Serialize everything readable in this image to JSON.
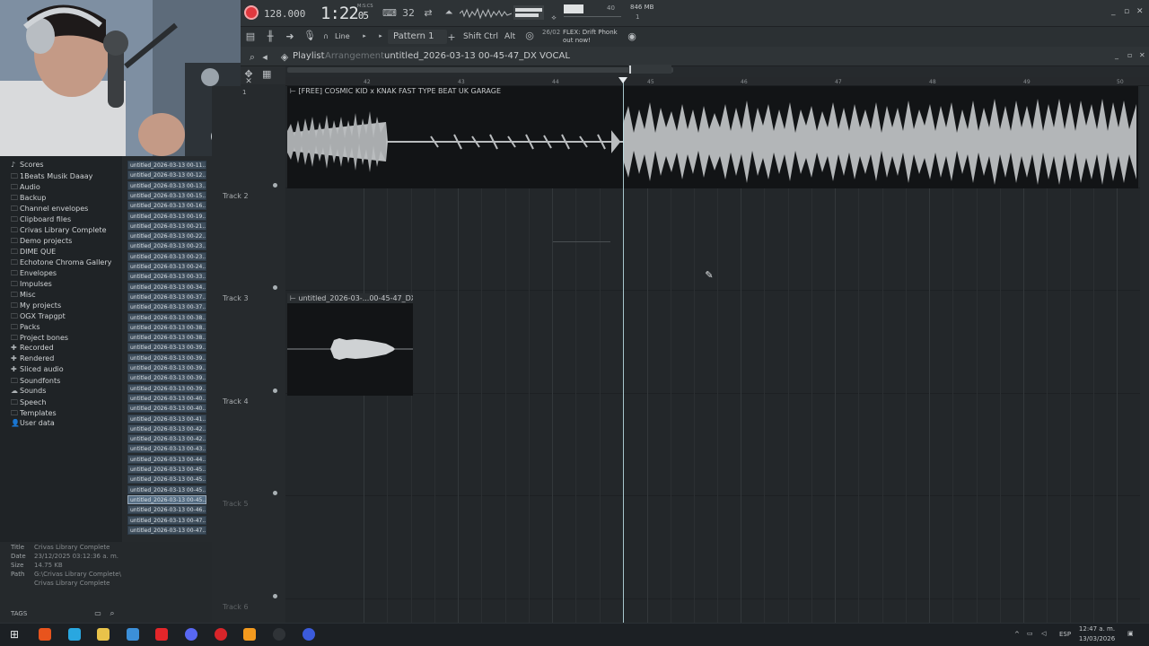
{
  "transport": {
    "tempo": "128.000",
    "time_main": "1:22",
    "time_sub": "05",
    "time_label": "M:S:CS",
    "step_label": "32",
    "master_level": "40",
    "memory": "846 MB",
    "memory_sub": "1",
    "snap": "Line",
    "pattern": "Pattern 1",
    "keys": [
      "Shift",
      "Ctrl",
      "Alt"
    ],
    "news_date": "26/02",
    "news_text": "FLEX: Drift Phonk out now!"
  },
  "playlist": {
    "title": "Playlist",
    "arrangement": "Arrangement",
    "clip_path": "untitled_2026-03-13 00-45-47_DX VOCAL",
    "ruler": [
      "42",
      "43",
      "44",
      "45",
      "46",
      "47",
      "48",
      "49",
      "50"
    ],
    "tracks": [
      "Track 2",
      "Track 3",
      "Track 4",
      "Track 5",
      "Track 6"
    ],
    "track1_number": "1",
    "clips": {
      "beat": "[FREE] COSMIC KID x KNAK FAST TYPE BEAT  UK GARAGE",
      "vocal": "untitled_2026-03-...00-45-47_DX VOCAL"
    }
  },
  "browser": {
    "items": [
      {
        "icon": "note-icon",
        "glyph": "♪",
        "label": "Scores"
      },
      {
        "icon": "folder-icon",
        "glyph": "🗀",
        "label": "1Beats Musik Daaay"
      },
      {
        "icon": "folder-icon",
        "glyph": "🗀",
        "label": "Audio"
      },
      {
        "icon": "folder-icon",
        "glyph": "🗀",
        "label": "Backup"
      },
      {
        "icon": "folder-icon",
        "glyph": "🗀",
        "label": "Channel envelopes"
      },
      {
        "icon": "folder-icon",
        "glyph": "🗀",
        "label": "Clipboard files"
      },
      {
        "icon": "folder-icon",
        "glyph": "🗀",
        "label": "Crivas Library Complete"
      },
      {
        "icon": "folder-icon",
        "glyph": "🗀",
        "label": "Demo projects"
      },
      {
        "icon": "folder-icon",
        "glyph": "🗀",
        "label": "DIME QUE"
      },
      {
        "icon": "folder-icon",
        "glyph": "🗀",
        "label": "Echotone Chroma Gallery"
      },
      {
        "icon": "folder-icon",
        "glyph": "🗀",
        "label": "Envelopes"
      },
      {
        "icon": "folder-icon",
        "glyph": "🗀",
        "label": "Impulses"
      },
      {
        "icon": "folder-icon",
        "glyph": "🗀",
        "label": "Misc"
      },
      {
        "icon": "folder-icon",
        "glyph": "🗀",
        "label": "My projects"
      },
      {
        "icon": "folder-icon",
        "glyph": "🗀",
        "label": "OGX Trapgpt"
      },
      {
        "icon": "folder-icon",
        "glyph": "🗀",
        "label": "Packs"
      },
      {
        "icon": "folder-icon",
        "glyph": "🗀",
        "label": "Project bones"
      },
      {
        "icon": "plus-icon",
        "glyph": "✚",
        "label": "Recorded"
      },
      {
        "icon": "plus-icon",
        "glyph": "✚",
        "label": "Rendered"
      },
      {
        "icon": "plus-icon",
        "glyph": "✚",
        "label": "Sliced audio"
      },
      {
        "icon": "folder-icon",
        "glyph": "🗀",
        "label": "Soundfonts"
      },
      {
        "icon": "cloud-icon",
        "glyph": "☁",
        "label": "Sounds"
      },
      {
        "icon": "folder-icon",
        "glyph": "🗀",
        "label": "Speech"
      },
      {
        "icon": "folder-icon",
        "glyph": "🗀",
        "label": "Templates"
      },
      {
        "icon": "user-icon",
        "glyph": "👤",
        "label": "User data"
      }
    ],
    "files": [
      "untitled_2026-03-13 00-11...",
      "untitled_2026-03-13 00-12...",
      "untitled_2026-03-13 00-13...",
      "untitled_2026-03-13 00-15...",
      "untitled_2026-03-13 00-16...",
      "untitled_2026-03-13 00-19...",
      "untitled_2026-03-13 00-21...",
      "untitled_2026-03-13 00-22...",
      "untitled_2026-03-13 00-23...",
      "untitled_2026-03-13 00-23...",
      "untitled_2026-03-13 00-24...",
      "untitled_2026-03-13 00-33...",
      "untitled_2026-03-13 00-34...",
      "untitled_2026-03-13 00-37...",
      "untitled_2026-03-13 00-37...",
      "untitled_2026-03-13 00-38...",
      "untitled_2026-03-13 00-38...",
      "untitled_2026-03-13 00-38...",
      "untitled_2026-03-13 00-39...",
      "untitled_2026-03-13 00-39...",
      "untitled_2026-03-13 00-39...",
      "untitled_2026-03-13 00-39...",
      "untitled_2026-03-13 00-39...",
      "untitled_2026-03-13 00-40...",
      "untitled_2026-03-13 00-40...",
      "untitled_2026-03-13 00-41...",
      "untitled_2026-03-13 00-42...",
      "untitled_2026-03-13 00-42...",
      "untitled_2026-03-13 00-43...",
      "untitled_2026-03-13 00-44...",
      "untitled_2026-03-13 00-45...",
      "untitled_2026-03-13 00-45...",
      "untitled_2026-03-13 00-45...",
      "untitled_2026-03-13 00-45...",
      "untitled_2026-03-13 00-46...",
      "untitled_2026-03-13 00-47...",
      "untitled_2026-03-13 00-47..."
    ],
    "selected_file_index": 33
  },
  "info": {
    "title_key": "Title",
    "title": "Crivas Library Complete",
    "date_key": "Date",
    "date": "23/12/2025 03:12:36 a. m.",
    "size_key": "Size",
    "size": "14.75 KB",
    "path_key": "Path",
    "path": "G:\\Crivas Library Complete\\",
    "path2": "Crivas Library Complete",
    "tags": "TAGS"
  },
  "taskbar": {
    "lang": "ESP",
    "time": "12:47 a. m.",
    "date": "13/03/2026"
  },
  "colors": {
    "record": "#e0383e",
    "playhead": "#bfe4ea",
    "waveform": "#c4c7c9",
    "file_bg": "#3f4e5c"
  }
}
